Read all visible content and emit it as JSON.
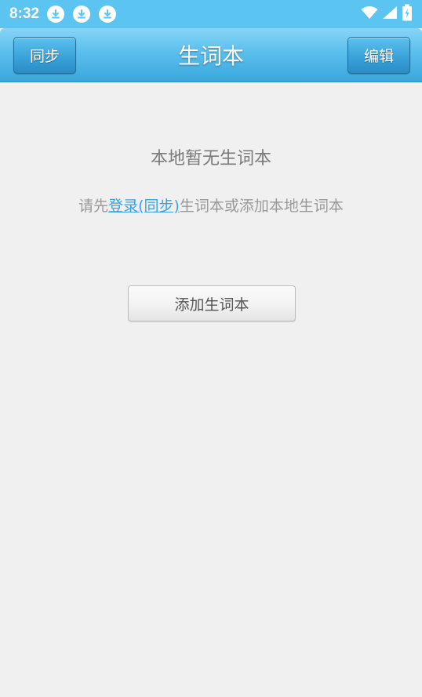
{
  "status_bar": {
    "time": "8:32",
    "notifications": [
      "download-icon",
      "download-icon",
      "download-icon"
    ],
    "right_icons": [
      "wifi-icon",
      "signal-icon",
      "battery-charging-icon"
    ]
  },
  "header": {
    "title": "生词本",
    "left_button": "同步",
    "right_button": "编辑",
    "colors": {
      "bar": "#5bbfec",
      "button": "#3aa3d9"
    }
  },
  "empty_state": {
    "title": "本地暂无生词本",
    "hint_prefix": "请先",
    "hint_link": "登录(同步)",
    "hint_suffix": "生词本或添加本地生词本",
    "link_color": "#3aa0e0"
  },
  "actions": {
    "add_button": "添加生词本"
  }
}
